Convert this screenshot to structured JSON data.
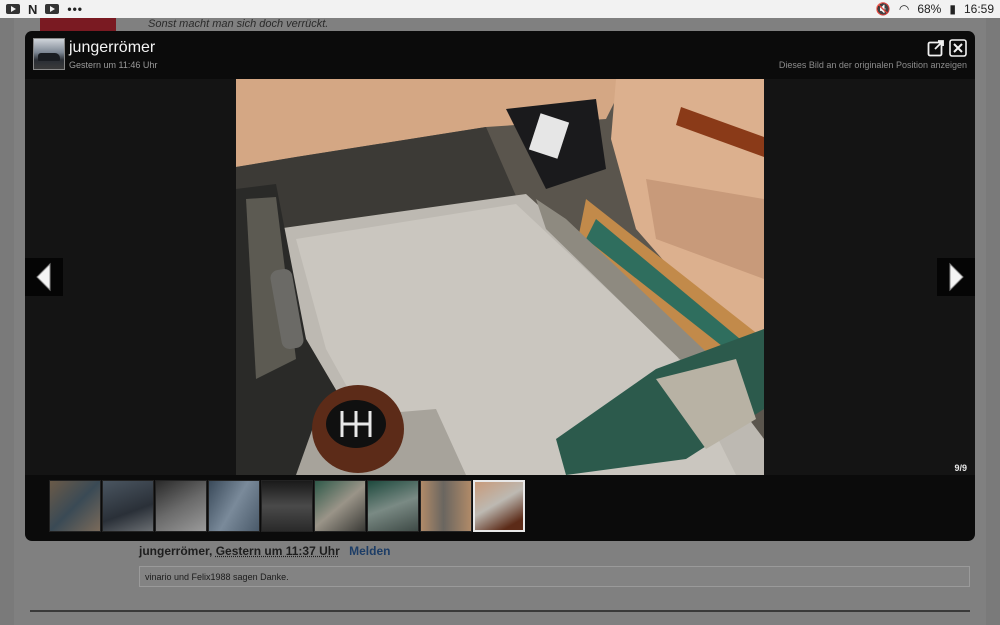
{
  "statusbar": {
    "battery": "68%",
    "time": "16:59"
  },
  "background": {
    "quote_text": "Sonst macht man sich doch verrückt.",
    "author": "jungerrömer",
    "author_time": "Gestern um 11:37 Uhr",
    "report_label": "Melden",
    "thanks_text": "vinario und Felix1988 sagen Danke."
  },
  "lightbox": {
    "title": "jungerrömer",
    "timestamp": "Gestern um 11:46 Uhr",
    "original_position_link": "Dieses Bild an der originalen Position anzeigen",
    "counter": "9/9",
    "thumb_count": 9,
    "active_index": 8,
    "icons": {
      "open_external": "external-link-icon",
      "close": "close-icon",
      "prev": "arrow-left-icon",
      "next": "arrow-right-icon"
    },
    "colors": {
      "backdrop": "#0b0b0b",
      "stage": "#141414",
      "text": "#f4f4f4",
      "muted": "#9a9a9a"
    }
  }
}
